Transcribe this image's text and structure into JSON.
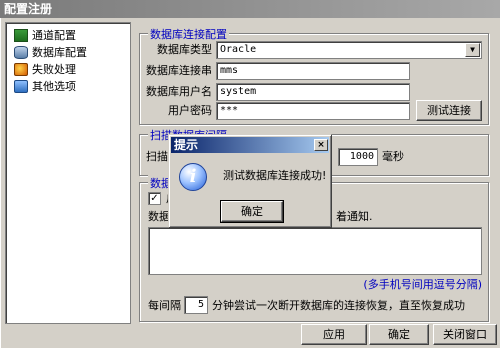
{
  "window": {
    "title": "配置注册"
  },
  "tree": {
    "items": [
      {
        "label": "通道配置",
        "icon": "channel-icon"
      },
      {
        "label": "数据库配置",
        "icon": "database-icon"
      },
      {
        "label": "失败处理",
        "icon": "failure-icon"
      },
      {
        "label": "其他选项",
        "icon": "options-icon"
      }
    ]
  },
  "db_group": {
    "title": "数据库连接配置",
    "type_label": "数据库类型",
    "type_value": "Oracle",
    "conn_label": "数据库连接串",
    "conn_value": "mms",
    "user_label": "数据库用户名",
    "user_value": "system",
    "pwd_label": "用户密码",
    "pwd_value": "***",
    "test_button": "测试连接"
  },
  "scan_group": {
    "title": "扫描数据库间隔",
    "label": "扫描",
    "value": "1000",
    "unit": "毫秒"
  },
  "notify_group": {
    "title": "数据",
    "checkbox_label": "启",
    "checkbox_checked": true,
    "desc_left": "数据",
    "desc_right": "着通知.",
    "hint": "(多手机号间用逗号分隔)",
    "retry_prefix": "每间隔",
    "retry_value": "5",
    "retry_suffix": "分钟尝试一次断开数据库的连接恢复，直至恢复成功"
  },
  "footer": {
    "apply": "应用",
    "ok": "确定",
    "close": "关闭窗口"
  },
  "dialog": {
    "title": "提示",
    "message": "测试数据库连接成功!",
    "ok": "确定",
    "close": "×",
    "icon": "info-icon"
  },
  "colors": {
    "group_title": "#0000c0",
    "dialog_title": "#0a246a"
  }
}
